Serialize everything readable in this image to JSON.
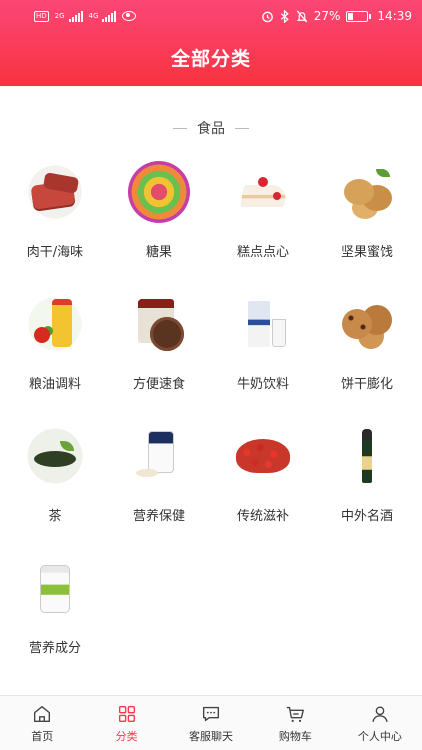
{
  "status_bar": {
    "network_badge": "HD",
    "signal1_type": "2G",
    "signal2_type": "4G",
    "battery": "27%",
    "battery_level": 0.27,
    "time": "14:39"
  },
  "header": {
    "title": "全部分类"
  },
  "section": {
    "title": "食品"
  },
  "categories": [
    {
      "label": "肉干/海味",
      "icon": "jerky-image"
    },
    {
      "label": "糖果",
      "icon": "candy-image"
    },
    {
      "label": "糕点点心",
      "icon": "cake-image"
    },
    {
      "label": "坚果蜜饯",
      "icon": "nuts-image"
    },
    {
      "label": "粮油调料",
      "icon": "oil-image"
    },
    {
      "label": "方便速食",
      "icon": "noodle-image"
    },
    {
      "label": "牛奶饮料",
      "icon": "milk-image"
    },
    {
      "label": "饼干膨化",
      "icon": "cookie-image"
    },
    {
      "label": "茶",
      "icon": "tea-image"
    },
    {
      "label": "营养保健",
      "icon": "nutrition-image"
    },
    {
      "label": "传统滋补",
      "icon": "goji-image"
    },
    {
      "label": "中外名酒",
      "icon": "wine-image"
    },
    {
      "label": "营养成分",
      "icon": "vitamin-image"
    }
  ],
  "tabbar": {
    "active_color": "#f23a4d",
    "items": [
      {
        "label": "首页",
        "icon": "home-icon"
      },
      {
        "label": "分类",
        "icon": "grid-icon"
      },
      {
        "label": "客服聊天",
        "icon": "chat-icon"
      },
      {
        "label": "购物车",
        "icon": "cart-icon"
      },
      {
        "label": "个人中心",
        "icon": "user-icon"
      }
    ]
  },
  "colors": {
    "header_top": "#fb4777",
    "header_bottom": "#f7333f"
  }
}
